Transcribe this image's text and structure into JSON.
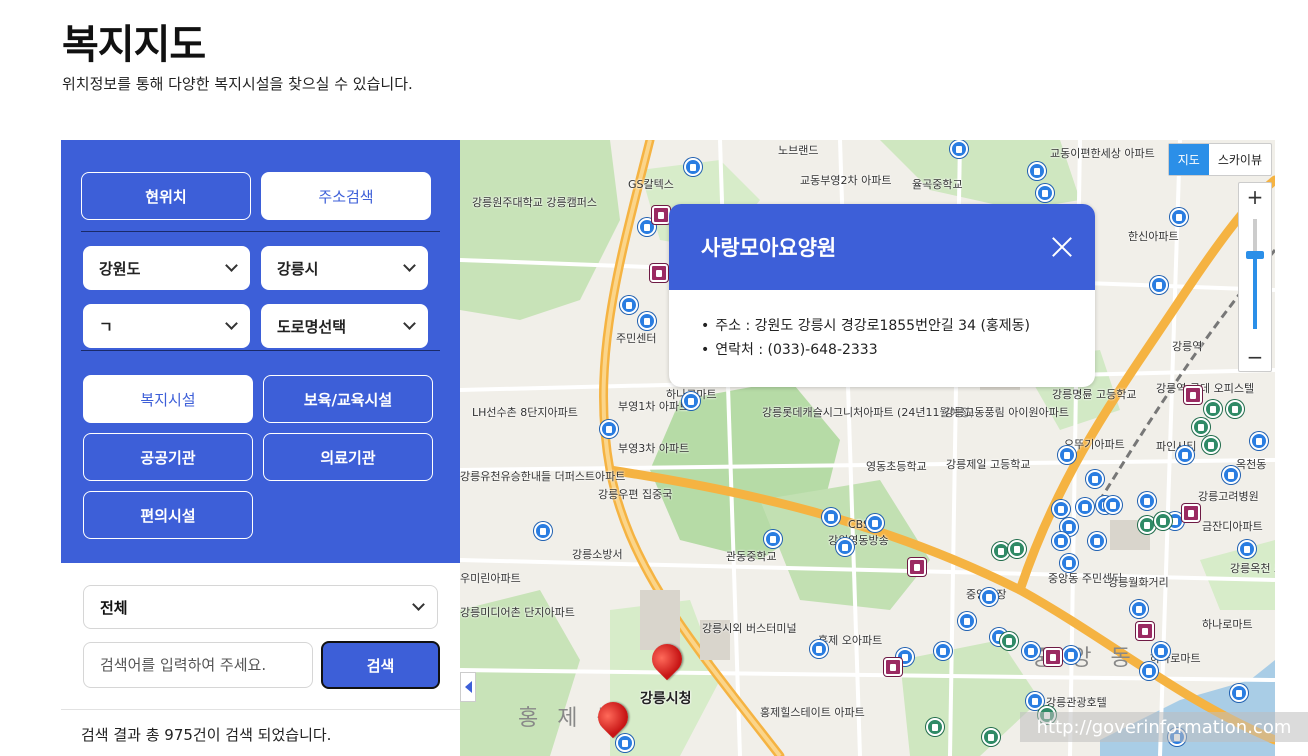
{
  "page": {
    "title": "복지지도",
    "subtitle": "위치정보를 통해 다양한 복지시설을 찾으실 수 있습니다."
  },
  "panel": {
    "location_buttons": {
      "current": "현위치",
      "address_search": "주소검색"
    },
    "region_selects": {
      "province": "강원도",
      "city": "강릉시",
      "initial": "ㄱ",
      "road": "도로명선택"
    },
    "categories": [
      "복지시설",
      "보육/교육시설",
      "공공기관",
      "의료기관",
      "편의시설"
    ],
    "filter_select": "전체",
    "search": {
      "placeholder": "검색어를 입력하여 주세요.",
      "button": "검색"
    },
    "result_text": "검색 결과 총 975건이 검색 되었습니다."
  },
  "map": {
    "type_toggle": {
      "map": "지도",
      "skyview": "스카이뷰"
    },
    "zoom": {
      "in": "+",
      "out": "−"
    },
    "labels": {
      "l1": "강릉원주대학교 강릉캠퍼스",
      "l2": "GS칼텍스",
      "l3": "교동부영2차 아파트",
      "l4": "노브랜드",
      "l5": "율곡중학교",
      "l6": "교동이편한세상 아파트",
      "l7": "한신아파트",
      "l8": "강릉역",
      "l9": "강릉명륜 고등학교",
      "l10": "강릉역 롯데 오피스텔",
      "l11": "하나로마트",
      "l12": "부영1차 아파트",
      "l13": "부영3차 아파트",
      "l14": "LH선수촌 8단지아파트",
      "l15": "강릉롯데캐슬시그니처아파트 (24년11월예정)",
      "l16": "강릉교동풍림 아이원아파트",
      "l17": "영동초등학교",
      "l18": "강릉제일 고등학교",
      "l19": "오뚜기아파트",
      "l20": "파인시티",
      "l21": "강릉고려병원",
      "l22": "금잔디아파트",
      "l23": "강릉우편 집중국",
      "l24": "강릉유천유승한내들 더퍼스트아파트",
      "l25": "CBS",
      "l26": "강원영동방송",
      "l27": "강릉소방서",
      "l28": "관동중학교",
      "l29": "우미린아파트",
      "l30": "중앙동 주민센터",
      "l31": "강릉월화거리",
      "l32": "강릉미디어촌 단지아파트",
      "l33": "강릉시외 버스터미널",
      "l34": "홍제 오아파트",
      "l35": "중앙시장",
      "l36": "하나로마트",
      "l37": "강릉시청",
      "l38": "홍제힐스테이트 아파트",
      "l39": "강릉관광호텔",
      "l40": "홍 제 동",
      "l41": "중 앙 동",
      "l42": "주민센터",
      "l43": "하나로마트",
      "l44": "옥천동",
      "l45": "강릉옥천 초등학교"
    },
    "info_window": {
      "title": "사랑모아요양원",
      "address": "주소 : 강원도 강릉시 경강로1855번안길 34 (홍제동)",
      "phone": "연락처 : (033)-648-2333"
    },
    "watermark": "http://goverinformation.com",
    "colors": {
      "accent": "#3d5fd8",
      "park": "#b6dba6",
      "road_major": "#f5b342",
      "road_minor": "#ffffff",
      "water": "#a9cde6"
    }
  }
}
